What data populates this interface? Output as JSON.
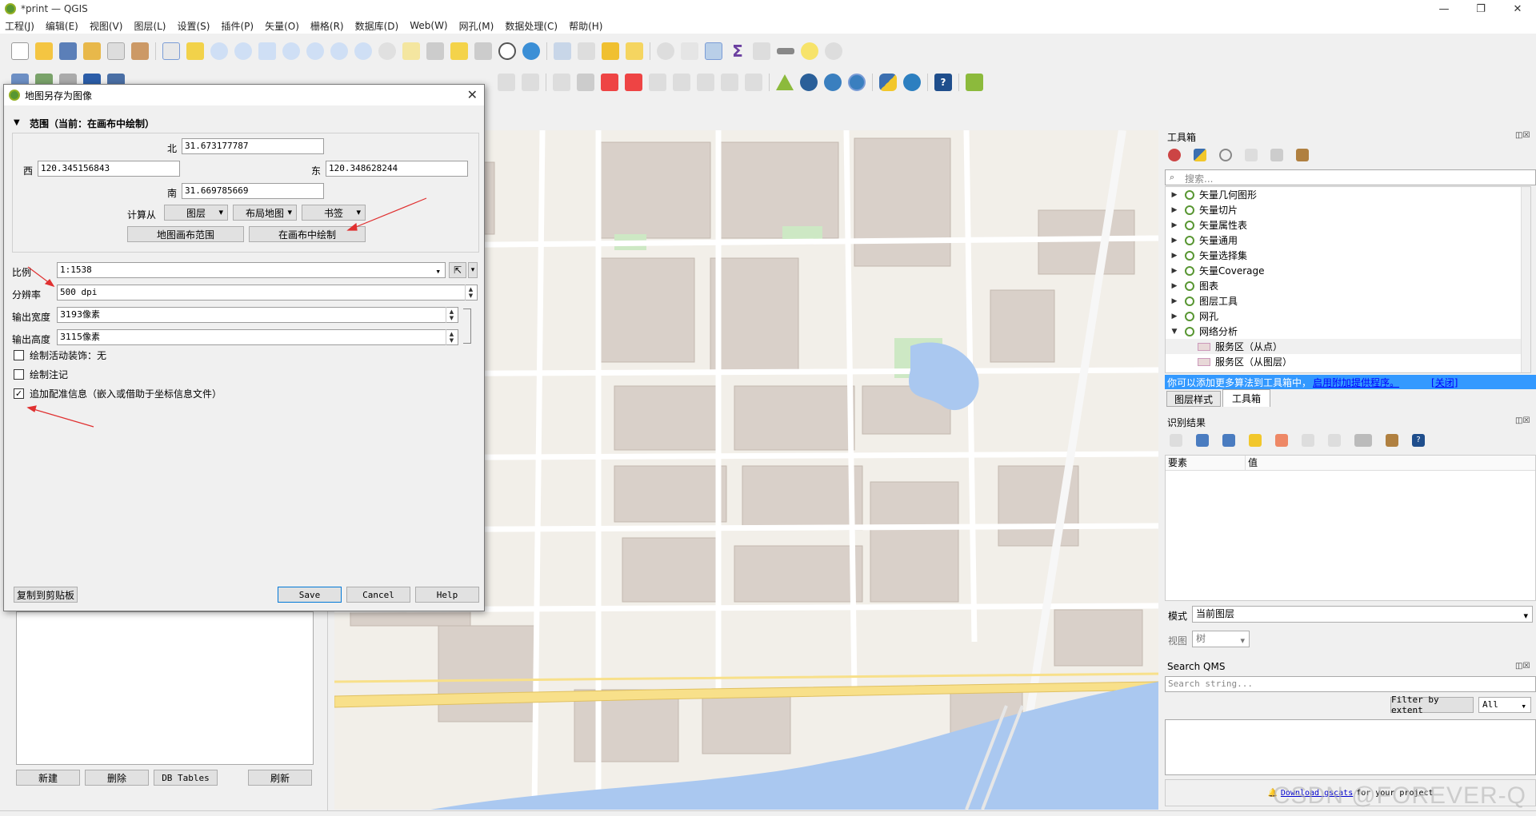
{
  "window": {
    "title": "*print — QGIS"
  },
  "menubar": [
    "工程(J)",
    "编辑(E)",
    "视图(V)",
    "图层(L)",
    "设置(S)",
    "插件(P)",
    "矢量(O)",
    "栅格(R)",
    "数据库(D)",
    "Web(W)",
    "网孔(M)",
    "数据处理(C)",
    "帮助(H)"
  ],
  "dialog": {
    "title": "地图另存为图像",
    "extent_header": "范围（当前：在画布中绘制）",
    "north_label": "北",
    "north": "31.673177787",
    "west_label": "西",
    "west": "120.345156843",
    "east_label": "东",
    "east": "120.348628244",
    "south_label": "南",
    "south": "31.669785669",
    "calc_from": "计算从",
    "calc_layer": "图层",
    "calc_layout": "布局地图",
    "calc_bookmark": "书签",
    "btn_map_canvas": "地图画布范围",
    "btn_draw_canvas": "在画布中绘制",
    "scale_label": "比例",
    "scale": "1:1538",
    "resolution_label": "分辨率",
    "resolution": "500 dpi",
    "width_label": "输出宽度",
    "width": "3193像素",
    "height_label": "输出高度",
    "height": "3115像素",
    "cb_decorations": "绘制活动装饰：无",
    "cb_annotations": "绘制注记",
    "cb_georef": "追加配准信息（嵌入或借助于坐标信息文件）",
    "copy_clipboard": "复制到剪贴板",
    "save": "Save",
    "cancel": "Cancel",
    "help": "Help"
  },
  "toolbox": {
    "title": "工具箱",
    "search_placeholder": "搜索...",
    "items": [
      {
        "label": "矢量几何图形"
      },
      {
        "label": "矢量切片"
      },
      {
        "label": "矢量属性表"
      },
      {
        "label": "矢量通用"
      },
      {
        "label": "矢量选择集"
      },
      {
        "label": "矢量Coverage"
      },
      {
        "label": "图表"
      },
      {
        "label": "图层工具"
      },
      {
        "label": "网孔"
      },
      {
        "label": "网络分析"
      }
    ],
    "subitems": [
      {
        "label": "服务区（从点）"
      },
      {
        "label": "服务区（从图层）"
      }
    ],
    "message": "你可以添加更多算法到工具箱中，",
    "message_link": "启用附加提供程序。",
    "message_close": "[关闭]"
  },
  "tabs": {
    "layer_style": "图层样式",
    "toolbox": "工具箱"
  },
  "identify": {
    "title": "识别结果",
    "col_feature": "要素",
    "col_value": "值",
    "mode_label": "模式",
    "mode_value": "当前图层",
    "view_label": "视图",
    "view_value": "树"
  },
  "qms": {
    "title": "Search QMS",
    "search_placeholder": "Search string...",
    "filter_extent": "Filter by extent",
    "filter_value": "All",
    "download_link": "Download gscats",
    "download_suffix": "for your project"
  },
  "browser_buttons": {
    "new": "新建",
    "delete": "删除",
    "db_tables": "DB Tables",
    "refresh": "刷新"
  },
  "watermark": "CSDN @FOREVER-Q",
  "colors": {
    "water": "#aac8f0",
    "road_yellow": "#f8e08a",
    "building": "#d9d0c9",
    "green": "#cde8c4",
    "accent": "#3399ff"
  }
}
